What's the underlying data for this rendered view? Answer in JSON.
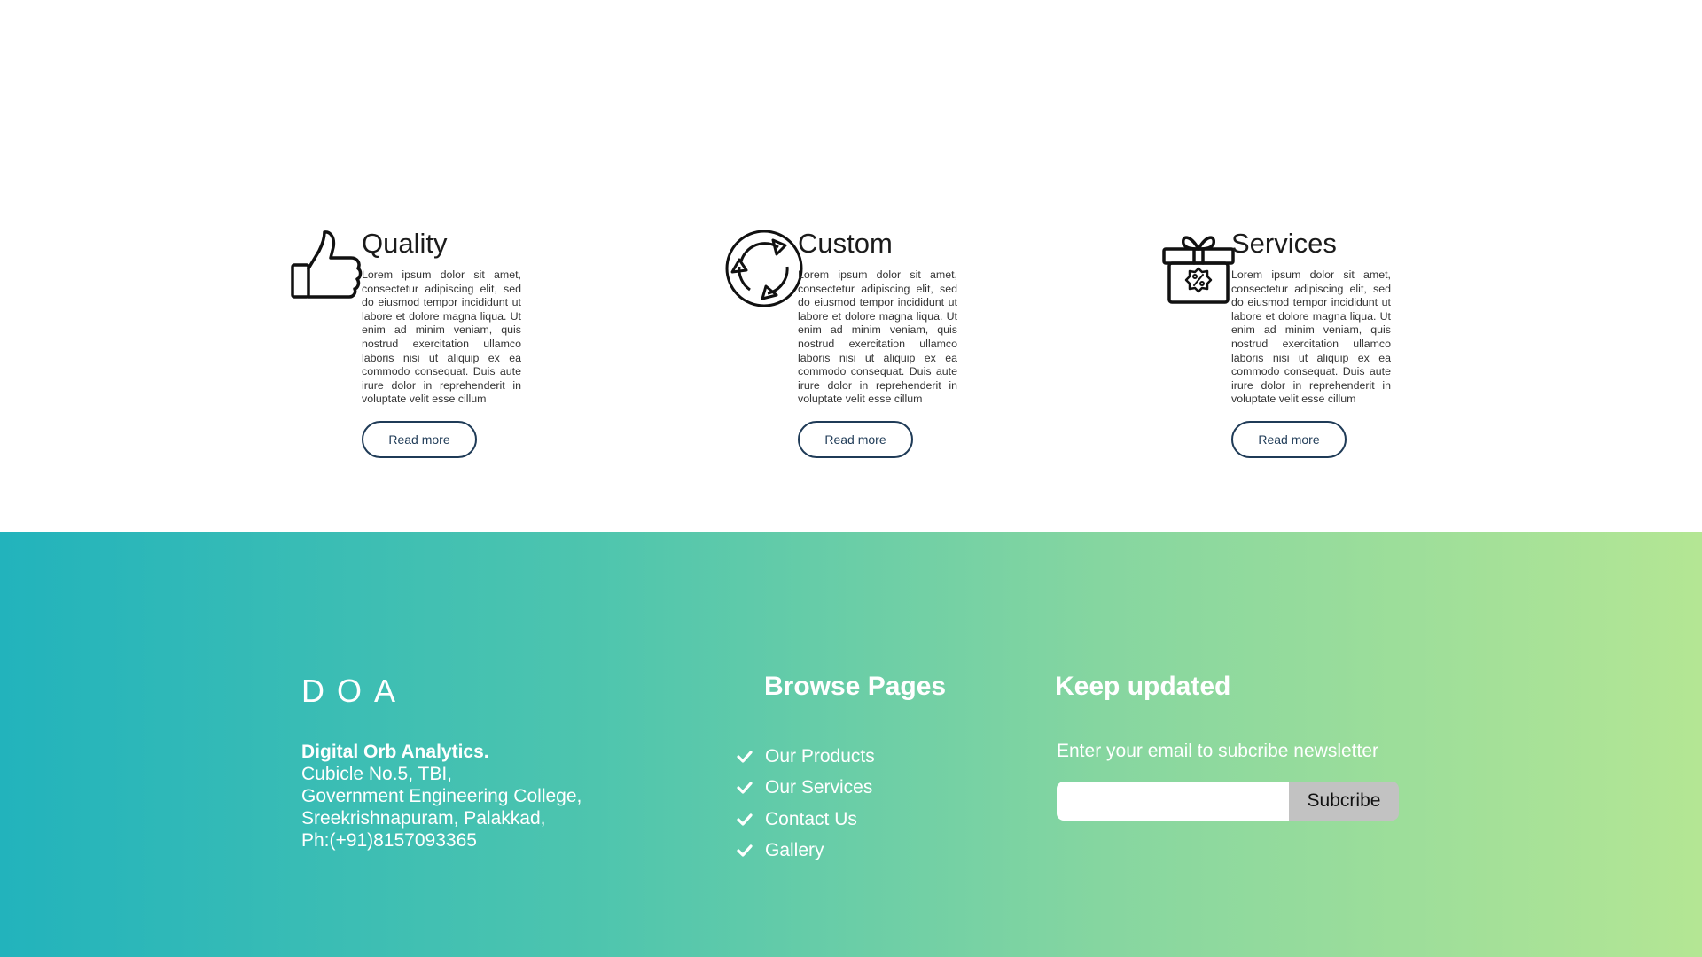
{
  "features": [
    {
      "icon": "thumbs-up-icon",
      "title": "Quality",
      "body": "Lorem ipsum dolor sit amet, consectetur adipiscing elit, sed do eiusmod tempor incididunt ut labore et dolore magna liqua. Ut enim ad minim veniam, quis nostrud exercitation ullamco laboris nisi ut aliquip ex ea commodo consequat. Duis aute irure dolor in reprehenderit in voluptate velit esse cillum",
      "button": "Read more"
    },
    {
      "icon": "recycle-arrows-icon",
      "title": "Custom",
      "body": "Lorem ipsum dolor sit amet, consectetur adipiscing elit, sed do eiusmod tempor incididunt ut labore et dolore magna liqua. Ut enim ad minim veniam, quis nostrud exercitation ullamco laboris nisi ut aliquip ex ea commodo consequat. Duis aute irure dolor in reprehenderit in voluptate velit esse cillum",
      "button": "Read more"
    },
    {
      "icon": "gift-discount-icon",
      "title": "Services",
      "body": "Lorem ipsum dolor sit amet, consectetur adipiscing elit, sed do eiusmod tempor incididunt ut labore et dolore magna liqua. Ut enim ad minim veniam, quis nostrud exercitation ullamco laboris nisi ut aliquip ex ea commodo consequat. Duis aute irure dolor in reprehenderit in voluptate velit esse cillum",
      "button": "Read more"
    }
  ],
  "footer": {
    "brand": "DOA",
    "company": {
      "name": "Digital Orb Analytics.",
      "lines": [
        "Cubicle No.5, TBI,",
        "Government Engineering College,",
        "Sreekrishnapuram, Palakkad,",
        "Ph:(+91)8157093365"
      ]
    },
    "browse": {
      "title": "Browse Pages",
      "items": [
        "Our Products",
        "Our Services",
        "Contact Us",
        "Gallery"
      ]
    },
    "newsletter": {
      "title": "Keep updated",
      "subtitle": "Enter your email to subcribe newsletter",
      "input_value": "",
      "button": "Subcribe"
    }
  },
  "colors": {
    "footer_gradient": [
      "#22b3bc",
      "#4ec5ae",
      "#86d6a0",
      "#b4e694"
    ],
    "button_border": "#1f3b57",
    "subscribe_bg": "#c2c2c2"
  }
}
